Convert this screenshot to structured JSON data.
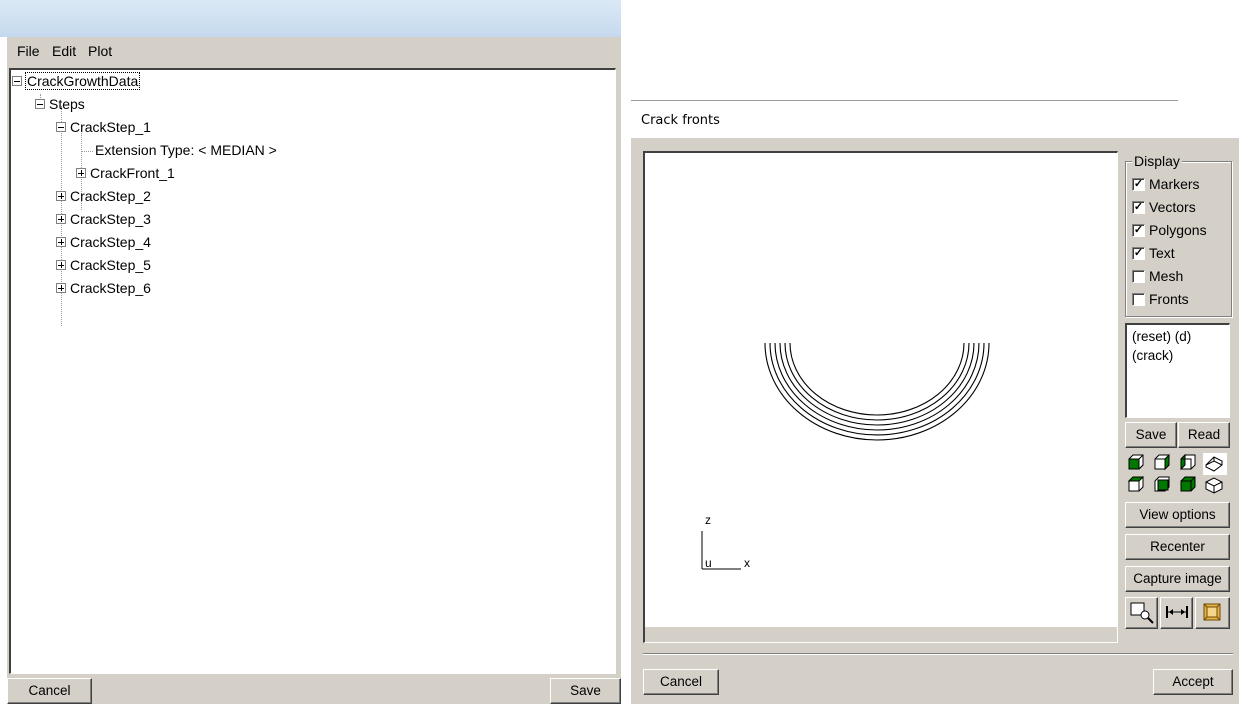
{
  "tree_window": {
    "menu": [
      "File",
      "Edit",
      "Plot"
    ],
    "tree": {
      "root": "CrackGrowthData",
      "steps_label": "Steps",
      "step1_label": "CrackStep_1",
      "extension_type": "Extension Type: < MEDIAN >",
      "crack_front": "CrackFront_1",
      "other_steps": [
        "CrackStep_2",
        "CrackStep_3",
        "CrackStep_4",
        "CrackStep_5",
        "CrackStep_6"
      ]
    },
    "cancel_label": "Cancel",
    "save_label": "Save"
  },
  "crack_fronts_window": {
    "title": "Crack fronts",
    "display_group": {
      "title": "Display",
      "options": [
        {
          "label": "Markers",
          "checked": true
        },
        {
          "label": "Vectors",
          "checked": true
        },
        {
          "label": "Polygons",
          "checked": true
        },
        {
          "label": "Text",
          "checked": true
        },
        {
          "label": "Mesh",
          "checked": false
        },
        {
          "label": "Fronts",
          "checked": false
        }
      ]
    },
    "view_list": [
      "(reset) (d)",
      "(crack)"
    ],
    "save_label": "Save",
    "read_label": "Read",
    "view_options_label": "View options",
    "recenter_label": "Recenter",
    "capture_image_label": "Capture image",
    "axes": {
      "z": "z",
      "u": "u",
      "x": "x"
    },
    "cancel_label": "Cancel",
    "accept_label": "Accept",
    "colors": {
      "cube_face": "#007800",
      "zoom_frame": "#c08a00"
    },
    "icons": [
      "view-front-icon",
      "view-back-icon",
      "view-right-icon",
      "view-iso-icon",
      "view-left-icon",
      "view-top-icon",
      "view-bottom-icon",
      "view-iso2-icon",
      "zoom-window-icon",
      "fit-width-icon",
      "zoom-box-icon"
    ]
  }
}
